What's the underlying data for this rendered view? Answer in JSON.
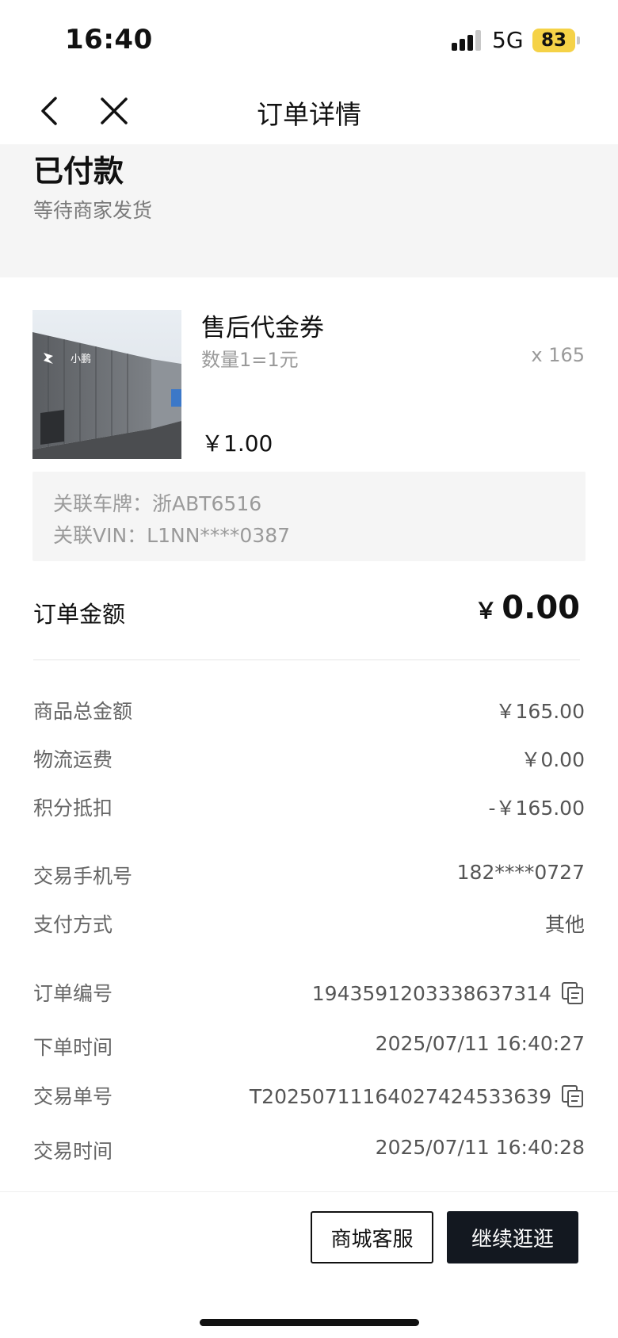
{
  "status_bar": {
    "time": "16:40",
    "network": "5G",
    "battery": "83"
  },
  "nav": {
    "title": "订单详情"
  },
  "order_status": {
    "title": "已付款",
    "subtitle": "等待商家发货"
  },
  "product": {
    "name": "售后代金券",
    "spec": "数量1=1元",
    "quantity": "x 165",
    "price": "￥1.00",
    "image_sign_text": "小鹏"
  },
  "vehicle": {
    "plate": "关联车牌：浙ABT6516",
    "vin": "关联VIN：L1NN****0387"
  },
  "order_amount": {
    "label": "订单金额",
    "currency": "￥",
    "value": "0.00"
  },
  "details": [
    {
      "label": "商品总金额",
      "value": "￥165.00"
    },
    {
      "label": "物流运费",
      "value": "￥0.00"
    },
    {
      "label": "积分抵扣",
      "value": "-￥165.00"
    },
    {
      "label": "交易手机号",
      "value": "182****0727"
    },
    {
      "label": "支付方式",
      "value": "其他"
    },
    {
      "label": "订单编号",
      "value": "1943591203338637314"
    },
    {
      "label": "下单时间",
      "value": "2025/07/11 16:40:27"
    },
    {
      "label": "交易单号",
      "value": "T2025071116402742453363​9"
    },
    {
      "label": "交易时间",
      "value": "2025/07/11 16:40:28"
    }
  ],
  "buttons": {
    "service": "商城客服",
    "continue": "继续逛逛"
  },
  "icons": {
    "back": "chevron-left-icon",
    "close": "close-icon",
    "copy": "copy-icon"
  }
}
